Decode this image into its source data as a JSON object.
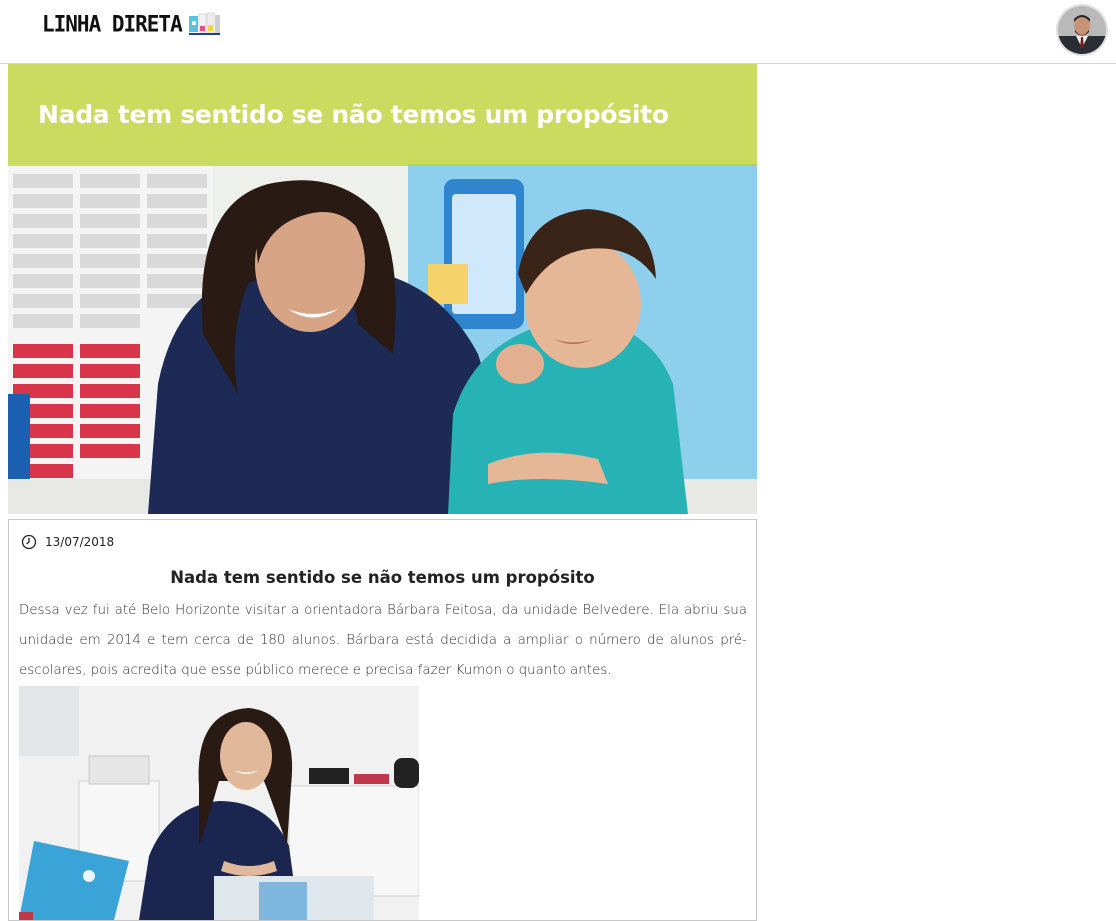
{
  "header": {
    "logo_text": "LINHA DIRETA",
    "logo_icon": "book-icon",
    "avatar_icon": "user-avatar"
  },
  "hero": {
    "title": "Nada tem sentido se não temos um propósito",
    "overlay_color": "#bcd228"
  },
  "post": {
    "date_icon": "clock-icon",
    "date": "13/07/2018",
    "title": "Nada tem sentido se não temos um propósito",
    "body": "Dessa vez fui até Belo Horizonte visitar a orientadora Bárbara Feitosa, da unidade Belvedere. Ela abriu sua unidade em 2014 e tem cerca de 180 alunos. Bárbara está decidida a ampliar o número de alunos pré-escolares, pois acredita que esse público merece e precisa fazer Kumon o quanto antes."
  }
}
